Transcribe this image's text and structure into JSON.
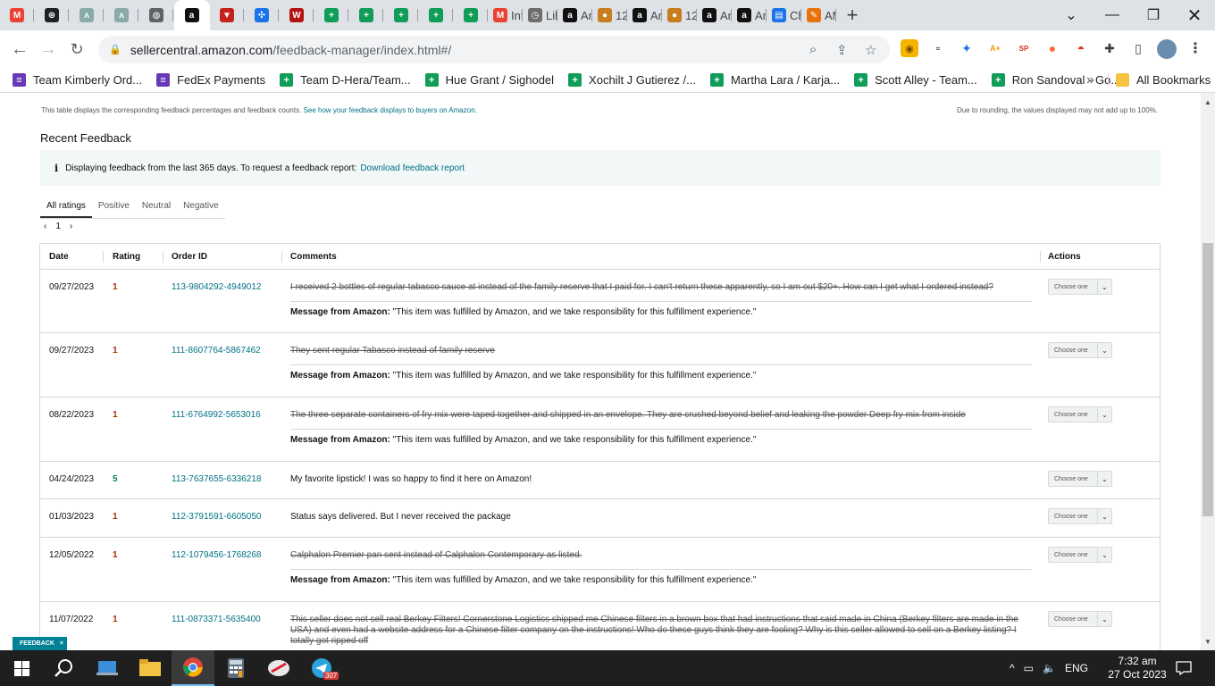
{
  "browser": {
    "tabs": [
      {
        "icon": "gmail-icon",
        "label": ""
      },
      {
        "icon": "openai-icon",
        "label": ""
      },
      {
        "icon": "extension-tab-icon",
        "label": ""
      },
      {
        "icon": "extension-tab-icon",
        "label": ""
      },
      {
        "icon": "globe-icon",
        "label": ""
      },
      {
        "icon": "amazon-icon",
        "label": "",
        "active": true
      },
      {
        "icon": "vpn-icon",
        "label": ""
      },
      {
        "icon": "app-icon",
        "label": ""
      },
      {
        "icon": "ww-icon",
        "label": ""
      },
      {
        "icon": "sheets-icon",
        "label": ""
      },
      {
        "icon": "sheets-icon",
        "label": ""
      },
      {
        "icon": "sheets-icon",
        "label": ""
      },
      {
        "icon": "sheets-icon",
        "label": ""
      },
      {
        "icon": "sheets-icon",
        "label": ""
      },
      {
        "icon": "gmail-icon",
        "label": "Int"
      },
      {
        "icon": "clock-icon",
        "label": "Lil"
      },
      {
        "icon": "amazon-icon",
        "label": "An"
      },
      {
        "icon": "coin-icon",
        "label": "12"
      },
      {
        "icon": "amazon-icon",
        "label": "An"
      },
      {
        "icon": "coin-icon",
        "label": "12"
      },
      {
        "icon": "amazon-icon",
        "label": "An"
      },
      {
        "icon": "amazon-icon",
        "label": "An"
      },
      {
        "icon": "chart-icon",
        "label": "Ch"
      },
      {
        "icon": "pen-icon",
        "label": "AM"
      }
    ],
    "new_tab": "+",
    "url_host": "sellercentral.amazon.com",
    "url_path": "/feedback-manager/index.html#/",
    "bookmarks": [
      {
        "icon": "forms-icon",
        "label": "Team Kimberly Ord..."
      },
      {
        "icon": "forms-icon",
        "label": "FedEx Payments"
      },
      {
        "icon": "sheets-icon",
        "label": "Team D-Hera/Team..."
      },
      {
        "icon": "sheets-icon",
        "label": "Hue Grant / Sighodel"
      },
      {
        "icon": "sheets-icon",
        "label": "Xochilt J Gutierez /..."
      },
      {
        "icon": "sheets-icon",
        "label": "Martha Lara / Karja..."
      },
      {
        "icon": "sheets-icon",
        "label": "Scott Alley - Team..."
      },
      {
        "icon": "sheets-icon",
        "label": "Ron Sandoval - Go..."
      }
    ],
    "bookmarks_more": "»",
    "all_bookmarks": "All Bookmarks"
  },
  "page": {
    "top_note_left": "This table displays the corresponding feedback percentages and feedback counts.",
    "top_note_link": "See how your feedback displays to buyers on Amazon.",
    "top_note_right": "Due to rounding, the values displayed may not add up to 100%.",
    "section_title": "Recent Feedback",
    "info_text": "Displaying feedback from the last 365 days. To request a feedback report:",
    "info_link": "Download feedback report",
    "filter_tabs": [
      "All ratings",
      "Positive",
      "Neutral",
      "Negative"
    ],
    "pager_prev": "‹",
    "pager_page": "1",
    "pager_next": "›",
    "columns": {
      "date": "Date",
      "rating": "Rating",
      "order_id": "Order ID",
      "comments": "Comments",
      "actions": "Actions"
    },
    "choose_label": "Choose one",
    "message_label": "Message from Amazon:",
    "message_text": "\"This item was fulfilled by Amazon, and we take responsibility for this fulfillment experience.\"",
    "rows": [
      {
        "date": "09/27/2023",
        "rating": "1",
        "order_id": "113-9804292-4949012",
        "comment": "I received 2 bottles of regular tabasco sauce at instead of the family reserve that I paid for. I can't return these apparently, so I am out $20+. How can I get what I ordered instead?",
        "struck": true,
        "has_message": true
      },
      {
        "date": "09/27/2023",
        "rating": "1",
        "order_id": "111-8607764-5867462",
        "comment": "They sent regular Tabasco instead of family reserve",
        "struck": true,
        "has_message": true
      },
      {
        "date": "08/22/2023",
        "rating": "1",
        "order_id": "111-6764992-5653016",
        "comment": "The three separate containers of fry mix were taped together and shipped in an envelope. They are crushed beyond belief and leaking the powder Deep fry mix from inside",
        "struck": true,
        "has_message": true
      },
      {
        "date": "04/24/2023",
        "rating": "5",
        "order_id": "113-7637655-6336218",
        "comment": "My favorite lipstick! I was so happy to find it here on Amazon!",
        "struck": false,
        "has_message": false
      },
      {
        "date": "01/03/2023",
        "rating": "1",
        "order_id": "112-3791591-6605050",
        "comment": "Status says delivered. But I never received the package",
        "struck": false,
        "has_message": false
      },
      {
        "date": "12/05/2022",
        "rating": "1",
        "order_id": "112-1079456-1768268",
        "comment": "Calphalon Premier pan sent instead of Calphalon Contemporary as listed.",
        "struck": true,
        "has_message": true
      },
      {
        "date": "11/07/2022",
        "rating": "1",
        "order_id": "111-0873371-5635400",
        "comment": "This seller does not sell real Berkey Filters! Cornerstone Logistics shipped me Chinese filters in a brown box that had instructions that said made in China (Berkey filters are made in the USA) and even had a website address for a Chinese filter company on the instructions! Who do these guys think they are fooling? Why is this seller allowed to sell on a Berkey listing? I totally got ripped off",
        "struck": true,
        "has_message": false
      }
    ],
    "feedback_tab": "FEEDBACK",
    "feedback_close": "×"
  },
  "colors": {
    "rating_low": "#b12704",
    "rating_high": "#067d62",
    "link": "#007185"
  },
  "taskbar": {
    "language": "ENG",
    "time": "7:32 am",
    "date": "27 Oct 2023",
    "telegram_badge": "307",
    "tray_chevron": "^"
  }
}
